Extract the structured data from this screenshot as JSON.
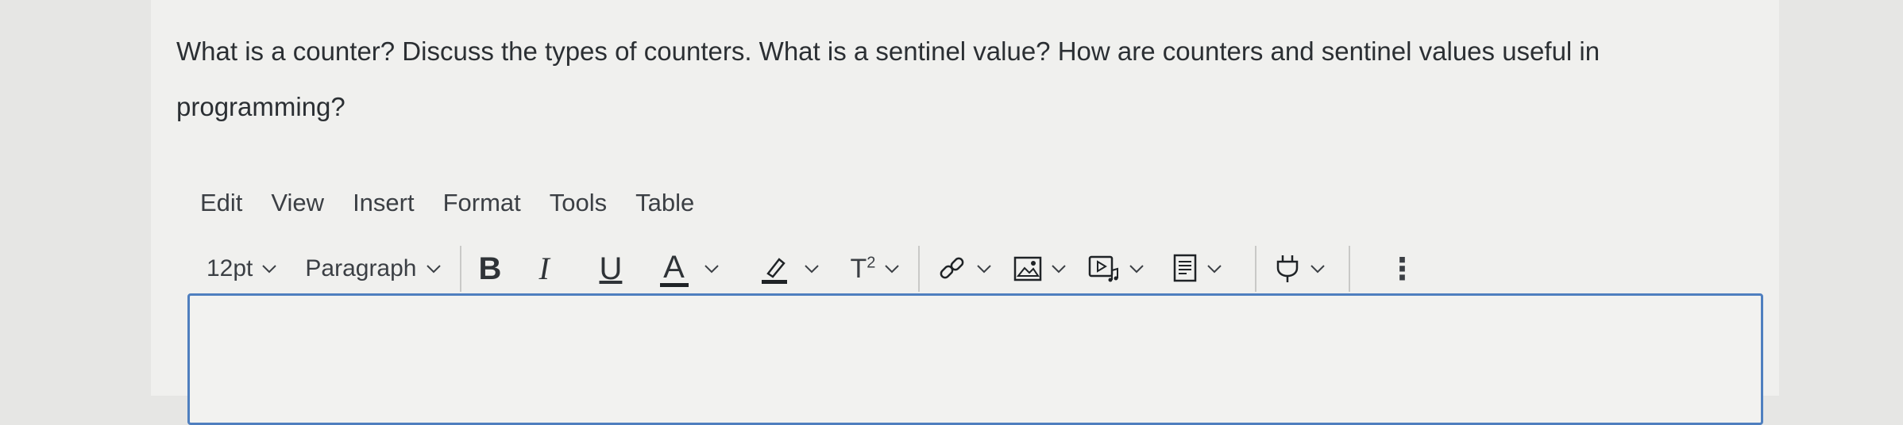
{
  "question": {
    "text": "What is a counter? Discuss the types of counters. What is a sentinel value? How are counters and sentinel values useful in programming?"
  },
  "menubar": {
    "items": [
      "Edit",
      "View",
      "Insert",
      "Format",
      "Tools",
      "Table"
    ]
  },
  "toolbar": {
    "font_size": "12pt",
    "block_format": "Paragraph",
    "bold": "B",
    "italic": "I",
    "underline": "U",
    "text_color": "A",
    "superscript": "T",
    "superscript_exp": "2",
    "more": "⋮"
  },
  "colors": {
    "editor_border": "#4f7fbf",
    "text": "#2d3b45"
  }
}
